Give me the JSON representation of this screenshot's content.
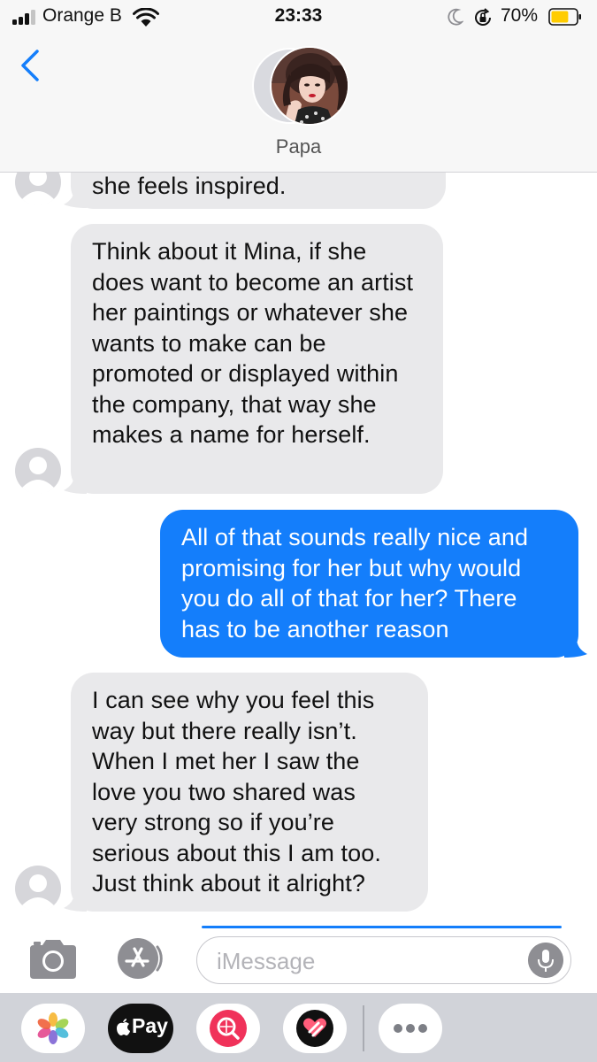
{
  "status_bar": {
    "carrier": "Orange B",
    "time": "23:33",
    "battery_percent": "70%",
    "battery_level": 0.7,
    "signal_bars": 3,
    "signal_bars_total": 4,
    "battery_color": "#ffcc00"
  },
  "header": {
    "contact_name": "Papa"
  },
  "messages": [
    {
      "sender": "contact",
      "text": "she feels inspired."
    },
    {
      "sender": "contact",
      "text": "Think about it Mina, if she does want to become an artist her paintings or whatever she wants to make can be promoted or displayed within the company, that way she makes a name for herself."
    },
    {
      "sender": "me",
      "text": "All of that sounds really nice and promising for her but why would you do all of that for her? There has to be another reason"
    },
    {
      "sender": "contact",
      "text": "I can see why you feel this way but there really isn’t. When I met her I saw the love you two shared was very strong so if you’re serious about this I am too. Just think about it alright?"
    }
  ],
  "composer": {
    "placeholder": "iMessage"
  },
  "app_drawer": {
    "apps": [
      {
        "icon": "photos-icon"
      },
      {
        "icon": "apple-pay-icon",
        "label": "Pay"
      },
      {
        "icon": "images-search-icon"
      },
      {
        "icon": "digital-touch-icon"
      },
      {
        "icon": "more-apps-icon"
      }
    ]
  },
  "colors": {
    "incoming_bubble": "#e9e9eb",
    "outgoing_bubble": "#147efb",
    "accent": "#147efb"
  }
}
